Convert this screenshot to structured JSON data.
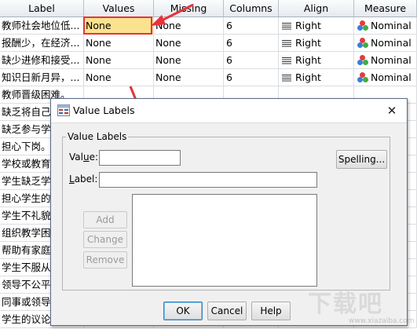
{
  "columns": {
    "label": "Label",
    "values": "Values",
    "missing": "Missing",
    "columns": "Columns",
    "align": "Align",
    "measure": "Measure"
  },
  "rows": [
    {
      "label": "教师社会地位低...",
      "values": "None",
      "missing": "None",
      "columns": "6",
      "align": "Right",
      "measure": "Nominal",
      "selected": true
    },
    {
      "label": "报酬少，在经济...",
      "values": "None",
      "missing": "None",
      "columns": "6",
      "align": "Right",
      "measure": "Nominal"
    },
    {
      "label": "缺少进修和接受...",
      "values": "None",
      "missing": "None",
      "columns": "6",
      "align": "Right",
      "measure": "Nominal"
    },
    {
      "label": "知识日新月异，...",
      "values": "None",
      "missing": "None",
      "columns": "6",
      "align": "Right",
      "measure": "Nominal"
    },
    {
      "label": "教师晋级困难。",
      "values": "",
      "missing": "",
      "columns": "",
      "align": "",
      "measure": ""
    },
    {
      "label": "缺乏将自己",
      "values": "",
      "missing": "",
      "columns": "",
      "align": "",
      "measure": "al"
    },
    {
      "label": "缺乏参与学",
      "values": "",
      "missing": "",
      "columns": "",
      "align": "",
      "measure": "al"
    },
    {
      "label": "担心下岗。",
      "values": "",
      "missing": "",
      "columns": "",
      "align": "",
      "measure": "al"
    },
    {
      "label": "学校或教育",
      "values": "",
      "missing": "",
      "columns": "",
      "align": "",
      "measure": "al"
    },
    {
      "label": "学生缺乏学",
      "values": "",
      "missing": "",
      "columns": "",
      "align": "",
      "measure": "al"
    },
    {
      "label": "担心学生的",
      "values": "",
      "missing": "",
      "columns": "",
      "align": "",
      "measure": "al"
    },
    {
      "label": "学生不礼貌",
      "values": "",
      "missing": "",
      "columns": "",
      "align": "",
      "measure": "al"
    },
    {
      "label": "组织教学困",
      "values": "",
      "missing": "",
      "columns": "",
      "align": "",
      "measure": "al"
    },
    {
      "label": "帮助有家庭",
      "values": "",
      "missing": "",
      "columns": "",
      "align": "",
      "measure": "al"
    },
    {
      "label": "学生不服从",
      "values": "",
      "missing": "",
      "columns": "",
      "align": "",
      "measure": "al"
    },
    {
      "label": "领导不公平",
      "values": "",
      "missing": "",
      "columns": "",
      "align": "",
      "measure": "al"
    },
    {
      "label": "同事或领导",
      "values": "",
      "missing": "",
      "columns": "",
      "align": "",
      "measure": "al"
    },
    {
      "label": "学生的议论",
      "values": "",
      "missing": "",
      "columns": "",
      "align": "",
      "measure": ""
    }
  ],
  "dialog": {
    "title": "Value Labels",
    "group_title": "Value Labels",
    "value_label": "Value:",
    "value_label_pre": "Val",
    "value_label_key": "u",
    "value_label_post": "e:",
    "label_label_key": "L",
    "label_label_post": "abel:",
    "value_input": "",
    "label_input": "",
    "spelling_button": "Spelling...",
    "add_button": "Add",
    "change_button": "Change",
    "remove_button": "Remove",
    "ok_button": "OK",
    "cancel_button": "Cancel",
    "help_button": "Help",
    "close_glyph": "✕"
  },
  "watermark": {
    "text": "下载吧",
    "url": "www.xiazaiba.com"
  },
  "colors": {
    "selected_cell": "#fbe28e",
    "highlight_outline": "#e8323c",
    "arrow": "#e8323c",
    "default_button_border": "#3c7fb1"
  }
}
